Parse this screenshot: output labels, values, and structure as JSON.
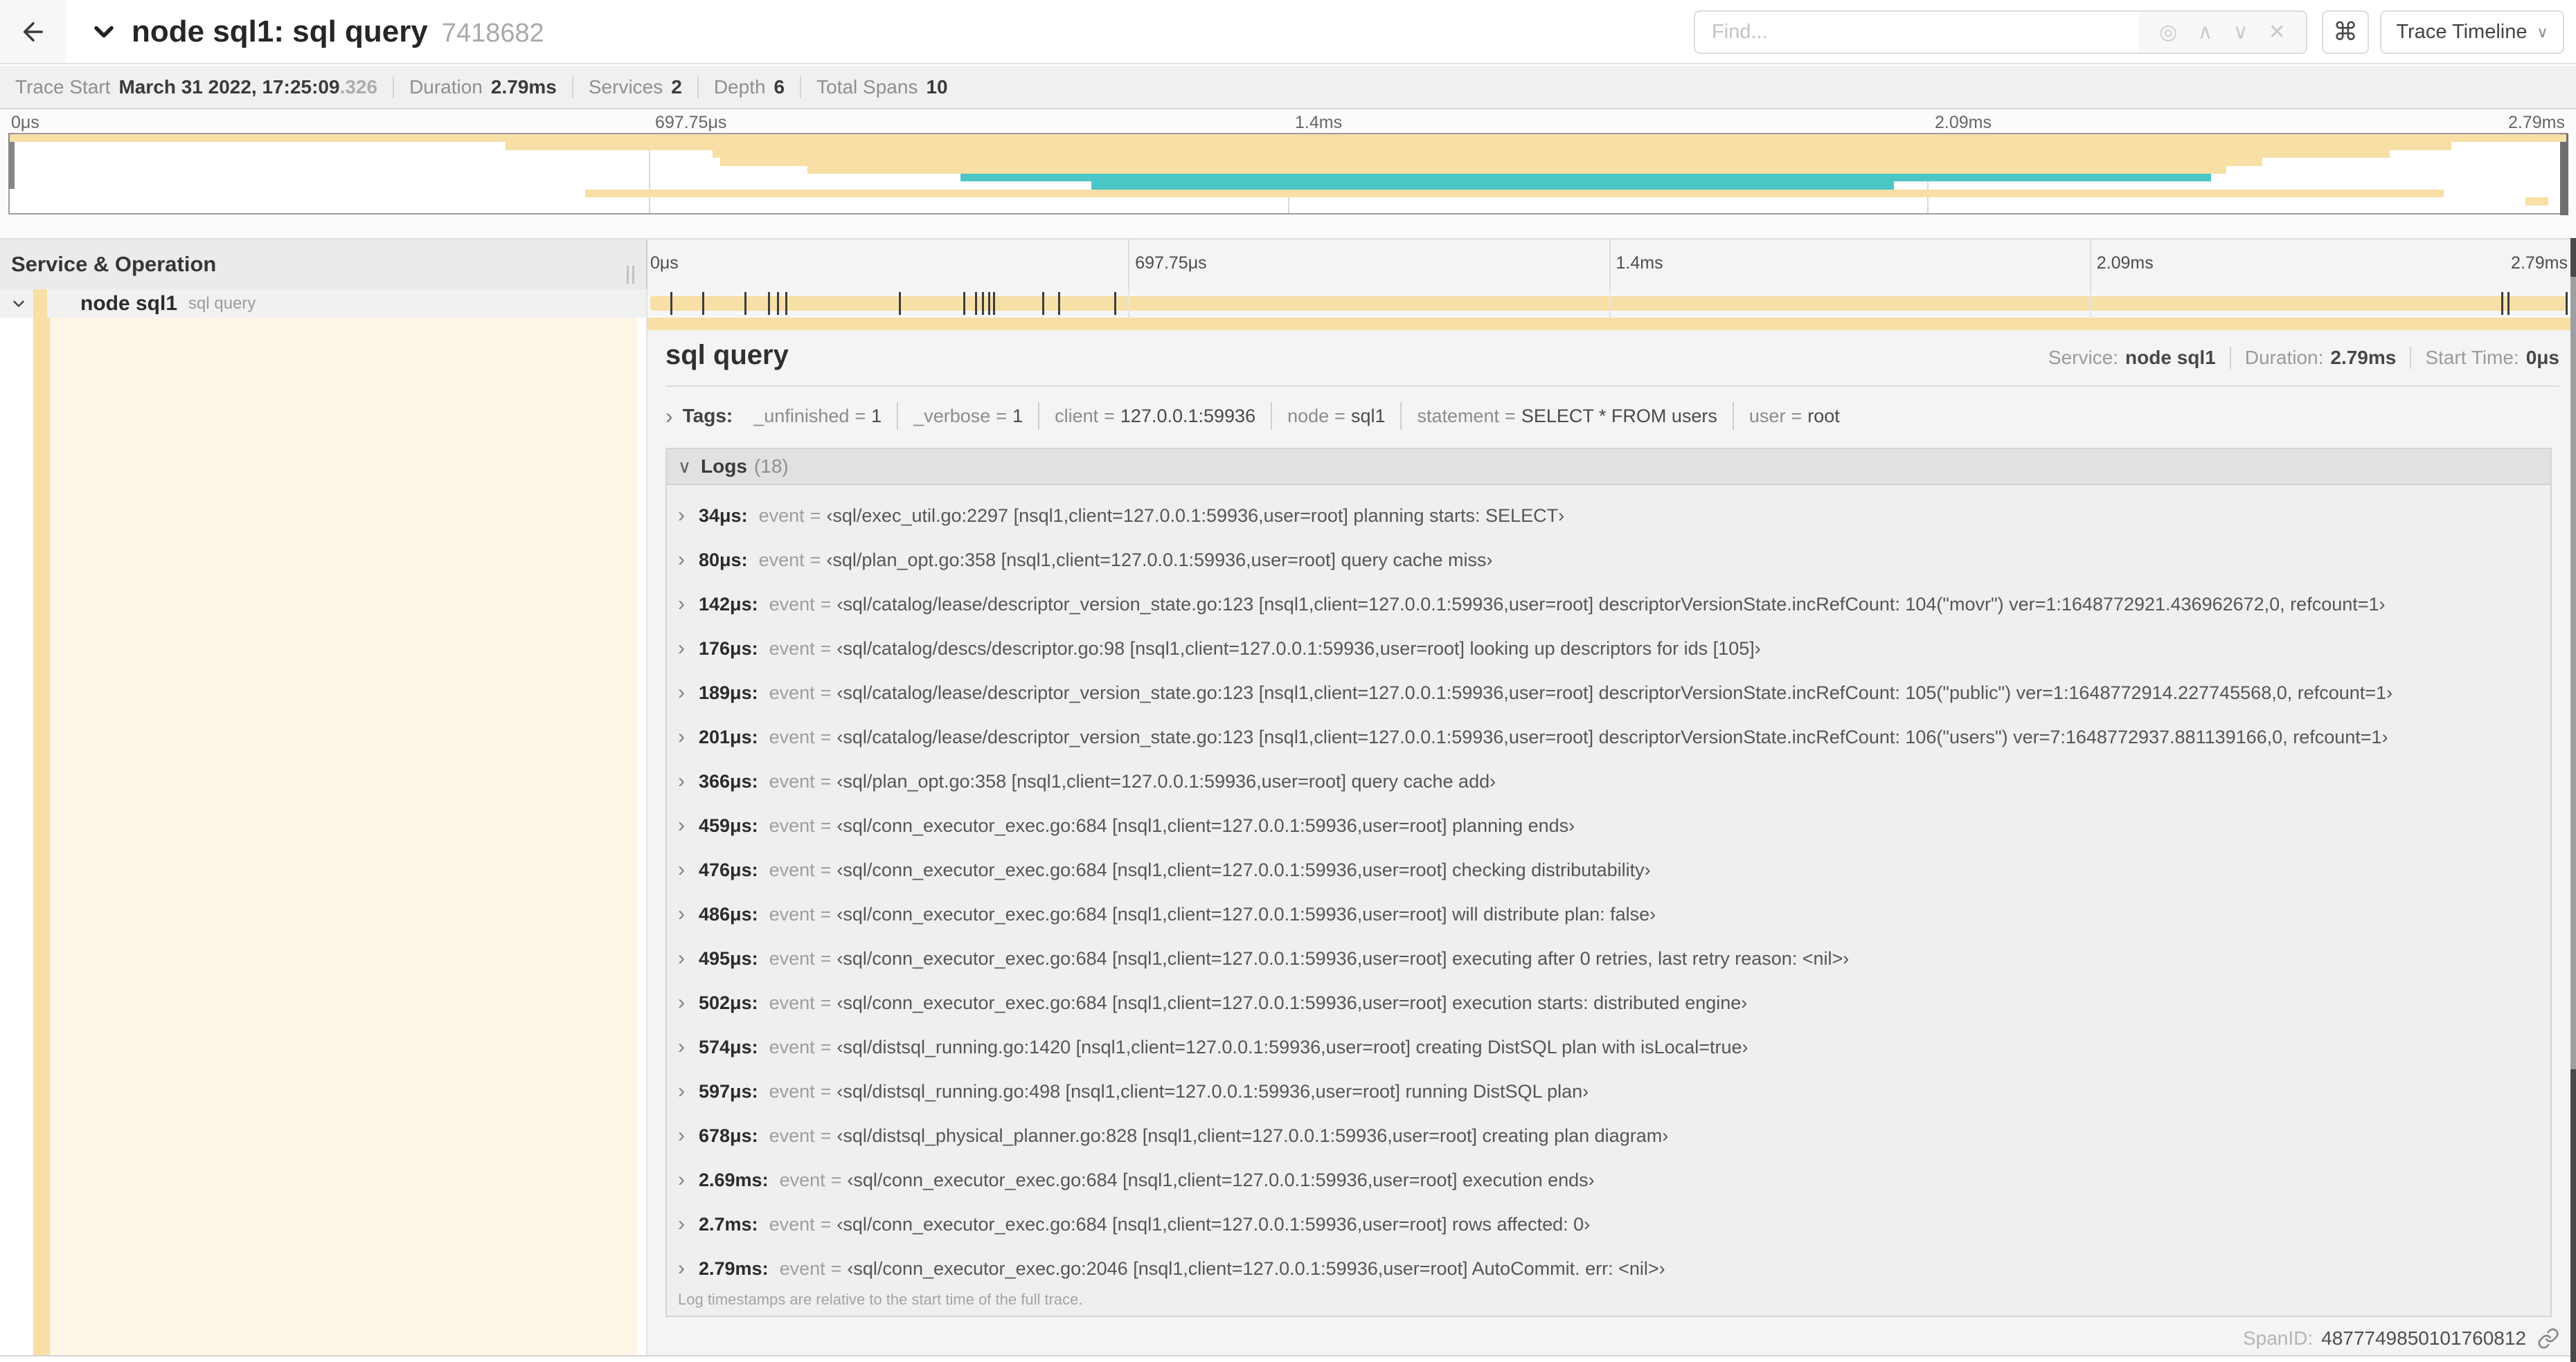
{
  "header": {
    "title": "node sql1: sql query",
    "trace_id": "7418682",
    "find_placeholder": "Find...",
    "shortcut_key": "⌘",
    "view_button": "Trace Timeline",
    "find_icons": {
      "locate": "◎",
      "prev": "∧",
      "next": "∨",
      "clear": "✕"
    }
  },
  "stats": {
    "trace_start_label": "Trace Start",
    "trace_start_value": "March 31 2022, 17:25:09",
    "trace_start_fraction": ".326",
    "duration_label": "Duration",
    "duration_value": "2.79ms",
    "services_label": "Services",
    "services_value": "2",
    "depth_label": "Depth",
    "depth_value": "6",
    "total_spans_label": "Total Spans",
    "total_spans_value": "10"
  },
  "timeline": {
    "ruler_ticks": [
      {
        "label": "0μs",
        "pct": 0
      },
      {
        "label": "697.75μs",
        "pct": 25
      },
      {
        "label": "1.4ms",
        "pct": 50
      },
      {
        "label": "2.09ms",
        "pct": 75
      },
      {
        "label": "2.79ms",
        "pct": 100
      }
    ],
    "left_header": "Service & Operation"
  },
  "minimap": {
    "rows": [
      {
        "row": 0,
        "color": "tan",
        "start": 0,
        "end": 100
      },
      {
        "row": 1,
        "color": "tan",
        "start": 19.4,
        "end": 95.5
      },
      {
        "row": 2,
        "color": "tan",
        "start": 27.5,
        "end": 93.1
      },
      {
        "row": 3,
        "color": "tan",
        "start": 27.8,
        "end": 88.1
      },
      {
        "row": 4,
        "color": "tan",
        "start": 31.2,
        "end": 86.7
      },
      {
        "row": 5,
        "color": "teal",
        "start": 37.2,
        "end": 86.1
      },
      {
        "row": 6,
        "color": "teal",
        "start": 42.3,
        "end": 73.7
      },
      {
        "row": 7,
        "color": "tan",
        "start": 22.5,
        "end": 95.2
      },
      {
        "row": 8,
        "color": "tan",
        "start": 98.4,
        "end": 99.3
      }
    ]
  },
  "span_row": {
    "service": "node sql1",
    "operation": "sql query"
  },
  "detail": {
    "title": "sql query",
    "service_label": "Service:",
    "service_value": "node sql1",
    "duration_label": "Duration:",
    "duration_value": "2.79ms",
    "start_label": "Start Time:",
    "start_value": "0μs",
    "tags_label": "Tags:",
    "tags": [
      {
        "key": "_unfinished",
        "value": "1"
      },
      {
        "key": "_verbose",
        "value": "1"
      },
      {
        "key": "client",
        "value": "127.0.0.1:59936"
      },
      {
        "key": "node",
        "value": "sql1"
      },
      {
        "key": "statement",
        "value": "SELECT * FROM users"
      },
      {
        "key": "user",
        "value": "root"
      }
    ],
    "logs_label": "Logs",
    "logs_count": "(18)",
    "log_format": {
      "key": "event",
      "eq": "=",
      "open": "‹",
      "close": "›",
      "colon": ":"
    },
    "logs": [
      {
        "time": "34μs",
        "pct": 1.22,
        "text": "sql/exec_util.go:2297 [nsql1,client=127.0.0.1:59936,user=root] planning starts: SELECT"
      },
      {
        "time": "80μs",
        "pct": 2.87,
        "text": "sql/plan_opt.go:358 [nsql1,client=127.0.0.1:59936,user=root] query cache miss"
      },
      {
        "time": "142μs",
        "pct": 5.09,
        "text": "sql/catalog/lease/descriptor_version_state.go:123 [nsql1,client=127.0.0.1:59936,user=root] descriptorVersionState.incRefCount: 104(\"movr\") ver=1:1648772921.436962672,0, refcount=1"
      },
      {
        "time": "176μs",
        "pct": 6.31,
        "text": "sql/catalog/descs/descriptor.go:98 [nsql1,client=127.0.0.1:59936,user=root] looking up descriptors for ids [105]"
      },
      {
        "time": "189μs",
        "pct": 6.77,
        "text": "sql/catalog/lease/descriptor_version_state.go:123 [nsql1,client=127.0.0.1:59936,user=root] descriptorVersionState.incRefCount: 105(\"public\") ver=1:1648772914.227745568,0, refcount=1"
      },
      {
        "time": "201μs",
        "pct": 7.2,
        "text": "sql/catalog/lease/descriptor_version_state.go:123 [nsql1,client=127.0.0.1:59936,user=root] descriptorVersionState.incRefCount: 106(\"users\") ver=7:1648772937.881139166,0, refcount=1"
      },
      {
        "time": "366μs",
        "pct": 13.12,
        "text": "sql/plan_opt.go:358 [nsql1,client=127.0.0.1:59936,user=root] query cache add"
      },
      {
        "time": "459μs",
        "pct": 16.45,
        "text": "sql/conn_executor_exec.go:684 [nsql1,client=127.0.0.1:59936,user=root] planning ends"
      },
      {
        "time": "476μs",
        "pct": 17.06,
        "text": "sql/conn_executor_exec.go:684 [nsql1,client=127.0.0.1:59936,user=root] checking distributability"
      },
      {
        "time": "486μs",
        "pct": 17.42,
        "text": "sql/conn_executor_exec.go:684 [nsql1,client=127.0.0.1:59936,user=root] will distribute plan: false"
      },
      {
        "time": "495μs",
        "pct": 17.74,
        "text": "sql/conn_executor_exec.go:684 [nsql1,client=127.0.0.1:59936,user=root] executing after 0 retries, last retry reason: <nil>"
      },
      {
        "time": "502μs",
        "pct": 18.0,
        "text": "sql/conn_executor_exec.go:684 [nsql1,client=127.0.0.1:59936,user=root] execution starts: distributed engine"
      },
      {
        "time": "574μs",
        "pct": 20.57,
        "text": "sql/distsql_running.go:1420 [nsql1,client=127.0.0.1:59936,user=root] creating DistSQL plan with isLocal=true"
      },
      {
        "time": "597μs",
        "pct": 21.4,
        "text": "sql/distsql_running.go:498 [nsql1,client=127.0.0.1:59936,user=root] running DistSQL plan"
      },
      {
        "time": "678μs",
        "pct": 24.3,
        "text": "sql/distsql_physical_planner.go:828 [nsql1,client=127.0.0.1:59936,user=root] creating plan diagram"
      },
      {
        "time": "2.69ms",
        "pct": 96.42,
        "text": "sql/conn_executor_exec.go:684 [nsql1,client=127.0.0.1:59936,user=root] execution ends"
      },
      {
        "time": "2.7ms",
        "pct": 96.77,
        "text": "sql/conn_executor_exec.go:684 [nsql1,client=127.0.0.1:59936,user=root] rows affected: 0"
      },
      {
        "time": "2.79ms",
        "pct": 100,
        "text": "sql/conn_executor_exec.go:2046 [nsql1,client=127.0.0.1:59936,user=root] AutoCommit. err: <nil>"
      }
    ],
    "logs_footnote": "Log timestamps are relative to the start time of the full trace.",
    "span_id_label": "SpanID:",
    "span_id_value": "4877749850101760812"
  },
  "colors": {
    "tan": "#f7dfa6",
    "teal": "#4bc6c6",
    "cream": "#fdf6e6"
  }
}
